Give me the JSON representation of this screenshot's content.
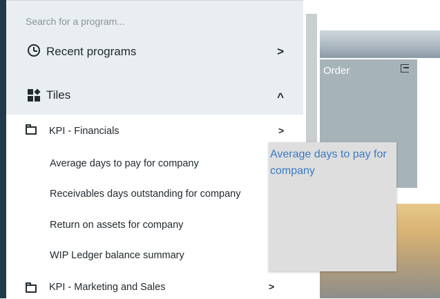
{
  "search": {
    "placeholder": "Search for a program..."
  },
  "menu": {
    "recent": {
      "label": "Recent programs",
      "chevron": ">"
    },
    "tiles": {
      "label": "Tiles",
      "chevron": "^"
    },
    "groups": [
      {
        "label": "KPI - Financials",
        "chevron": ">",
        "items": [
          "Average days to pay for company",
          "Receivables days outstanding for company",
          "Return on assets for company",
          "WIP Ledger balance summary"
        ]
      },
      {
        "label": "KPI - Marketing and Sales",
        "chevron": ">"
      }
    ]
  },
  "background": {
    "tile_title": "es Order\nry"
  },
  "tooltip": {
    "text": "Average days to pay for company"
  },
  "colors": {
    "menu_header": "#e9eef0",
    "link": "#3a79c2",
    "tooltip_bg": "#dedede",
    "tile_bg": "#a6b3b8"
  },
  "icons": [
    "clock-icon",
    "tiles-icon",
    "folder-icon",
    "chevron-right-icon",
    "chevron-up-icon",
    "pin-to-dashboard-icon"
  ]
}
